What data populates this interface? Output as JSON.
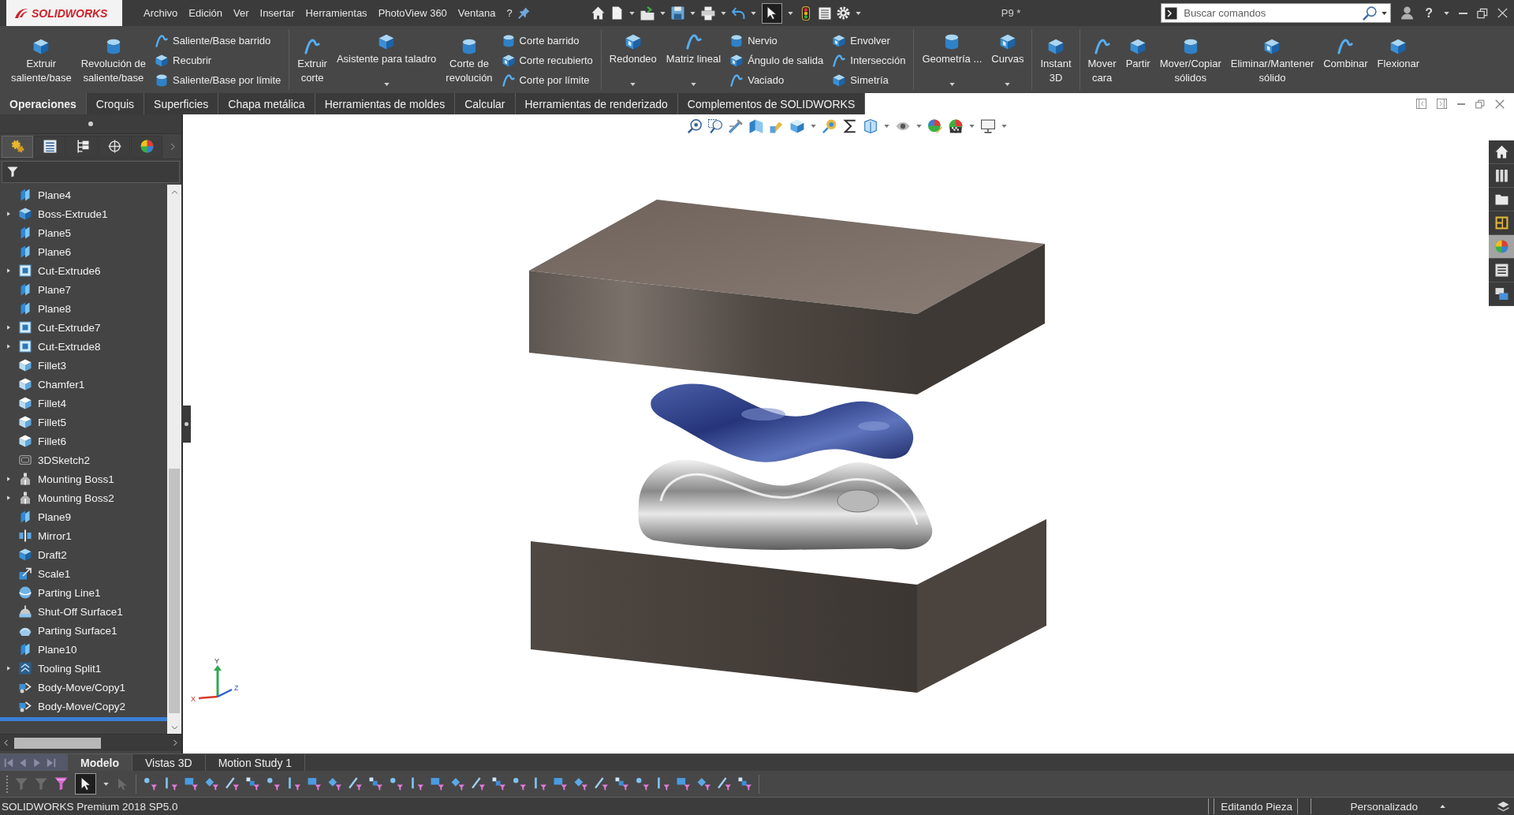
{
  "title_bar": {
    "logo": "SOLIDWORKS",
    "menu": [
      "Archivo",
      "Edición",
      "Ver",
      "Insertar",
      "Herramientas",
      "PhotoView 360",
      "Ventana",
      "?"
    ],
    "quick_access": {
      "select_pressed": true
    },
    "document_title": "P9 *",
    "search": {
      "placeholder": "Buscar comandos"
    },
    "help": "?"
  },
  "command_manager": {
    "groups": [
      {
        "items": [
          {
            "kind": "large",
            "lines": [
              "Extruir",
              "saliente/base"
            ],
            "dropdown": false
          },
          {
            "kind": "large",
            "lines": [
              "Revolución de",
              "saliente/base"
            ],
            "dropdown": false
          },
          {
            "kind": "stack",
            "entries": [
              "Saliente/Base barrido",
              "Recubrir",
              "Saliente/Base por límite"
            ]
          }
        ]
      },
      {
        "items": [
          {
            "kind": "large",
            "lines": [
              "Extruir",
              "corte"
            ],
            "dropdown": false
          },
          {
            "kind": "large",
            "lines": [
              "Asistente para taladro"
            ],
            "dropdown": true
          },
          {
            "kind": "large",
            "lines": [
              "Corte de",
              "revolución"
            ],
            "dropdown": false
          },
          {
            "kind": "stack",
            "entries": [
              "Corte barrido",
              "Corte recubierto",
              "Corte por límite"
            ]
          }
        ]
      },
      {
        "items": [
          {
            "kind": "large",
            "lines": [
              "Redondeo"
            ],
            "dropdown": true
          },
          {
            "kind": "large",
            "lines": [
              "Matriz lineal"
            ],
            "dropdown": true
          },
          {
            "kind": "stack",
            "entries": [
              "Nervio",
              "Ángulo de salida",
              "Vaciado"
            ]
          },
          {
            "kind": "stack",
            "entries": [
              "Envolver",
              "Intersección",
              "Simetría"
            ]
          }
        ]
      },
      {
        "items": [
          {
            "kind": "large",
            "lines": [
              "Geometría ..."
            ],
            "dropdown": true
          },
          {
            "kind": "large",
            "lines": [
              "Curvas"
            ],
            "dropdown": true
          }
        ]
      },
      {
        "items": [
          {
            "kind": "large",
            "lines": [
              "Instant",
              "3D"
            ],
            "dropdown": false
          }
        ]
      },
      {
        "items": [
          {
            "kind": "large",
            "lines": [
              "Mover",
              "cara"
            ],
            "dropdown": false
          },
          {
            "kind": "large",
            "lines": [
              "Partir"
            ],
            "dropdown": false
          },
          {
            "kind": "large",
            "lines": [
              "Mover/Copiar",
              "sólidos"
            ],
            "dropdown": false
          },
          {
            "kind": "large",
            "lines": [
              "Eliminar/Mantener",
              "sólido"
            ],
            "dropdown": false
          },
          {
            "kind": "large",
            "lines": [
              "Combinar"
            ],
            "dropdown": false
          },
          {
            "kind": "large",
            "lines": [
              "Flexionar"
            ],
            "dropdown": false
          }
        ]
      }
    ]
  },
  "tabs": [
    {
      "label": "Operaciones",
      "selected": true
    },
    {
      "label": "Croquis",
      "selected": false
    },
    {
      "label": "Superficies",
      "selected": false
    },
    {
      "label": "Chapa metálica",
      "selected": false
    },
    {
      "label": "Herramientas de moldes",
      "selected": false
    },
    {
      "label": "Calcular",
      "selected": false
    },
    {
      "label": "Herramientas de renderizado",
      "selected": false
    },
    {
      "label": "Complementos de SOLIDWORKS",
      "selected": false
    }
  ],
  "feature_manager": {
    "panel_tabs": [
      {
        "kind": "feature_manager",
        "selected": true
      },
      {
        "kind": "property_manager",
        "selected": false
      },
      {
        "kind": "configuration_manager",
        "selected": false
      },
      {
        "kind": "dimxpert",
        "selected": false
      },
      {
        "kind": "display_manager",
        "selected": false
      }
    ],
    "tree": [
      {
        "label": "Plane4",
        "kind": "plane",
        "expandable": false
      },
      {
        "label": "Boss-Extrude1",
        "kind": "extrude",
        "expandable": true,
        "expanded": false
      },
      {
        "label": "Plane5",
        "kind": "plane",
        "expandable": false
      },
      {
        "label": "Plane6",
        "kind": "plane",
        "expandable": false
      },
      {
        "label": "Cut-Extrude6",
        "kind": "cut",
        "expandable": true,
        "expanded": false
      },
      {
        "label": "Plane7",
        "kind": "plane",
        "expandable": false
      },
      {
        "label": "Plane8",
        "kind": "plane",
        "expandable": false
      },
      {
        "label": "Cut-Extrude7",
        "kind": "cut",
        "expandable": true,
        "expanded": false
      },
      {
        "label": "Cut-Extrude8",
        "kind": "cut",
        "expandable": true,
        "expanded": false
      },
      {
        "label": "Fillet3",
        "kind": "fillet",
        "expandable": false
      },
      {
        "label": "Chamfer1",
        "kind": "chamfer",
        "expandable": false
      },
      {
        "label": "Fillet4",
        "kind": "fillet",
        "expandable": false
      },
      {
        "label": "Fillet5",
        "kind": "fillet",
        "expandable": false
      },
      {
        "label": "Fillet6",
        "kind": "fillet",
        "expandable": false
      },
      {
        "label": "3DSketch2",
        "kind": "sketch",
        "expandable": false
      },
      {
        "label": "Mounting Boss1",
        "kind": "boss",
        "expandable": true,
        "expanded": false
      },
      {
        "label": "Mounting Boss2",
        "kind": "boss",
        "expandable": true,
        "expanded": false
      },
      {
        "label": "Plane9",
        "kind": "plane",
        "expandable": false
      },
      {
        "label": "Mirror1",
        "kind": "mirror",
        "expandable": false
      },
      {
        "label": "Draft2",
        "kind": "draft",
        "expandable": false
      },
      {
        "label": "Scale1",
        "kind": "scale",
        "expandable": false
      },
      {
        "label": "Parting Line1",
        "kind": "parting_line",
        "expandable": false
      },
      {
        "label": "Shut-Off Surface1",
        "kind": "shutoff_surface",
        "expandable": false
      },
      {
        "label": "Parting Surface1",
        "kind": "parting_surface",
        "expandable": false
      },
      {
        "label": "Plane10",
        "kind": "plane",
        "expandable": false
      },
      {
        "label": "Tooling Split1",
        "kind": "split",
        "expandable": true,
        "expanded": false
      },
      {
        "label": "Body-Move/Copy1",
        "kind": "move",
        "expandable": false
      },
      {
        "label": "Body-Move/Copy2",
        "kind": "move",
        "expandable": false
      }
    ]
  },
  "viewport": {
    "task_pane": [
      {
        "kind": "home",
        "selected": false
      },
      {
        "kind": "design_library",
        "selected": false
      },
      {
        "kind": "file_explorer",
        "selected": false
      },
      {
        "kind": "view_palette",
        "selected": false
      },
      {
        "kind": "appearances",
        "selected": true
      },
      {
        "kind": "custom_properties",
        "selected": false
      },
      {
        "kind": "forum",
        "selected": false
      }
    ],
    "triad": {
      "x": "X",
      "y": "Y",
      "z": "Z"
    }
  },
  "bottom_bar": {
    "scroll_buttons": {
      "disabled": true
    },
    "tabs": [
      {
        "label": "Modelo",
        "selected": true
      },
      {
        "label": "Vistas 3D",
        "selected": false
      },
      {
        "label": "Motion Study 1",
        "selected": false
      }
    ],
    "selection_filter": {
      "select_pressed": true
    }
  },
  "status_bar": {
    "product": "SOLIDWORKS Premium 2018 SP5.0",
    "mode": "Editando Pieza",
    "units": "Personalizado"
  }
}
